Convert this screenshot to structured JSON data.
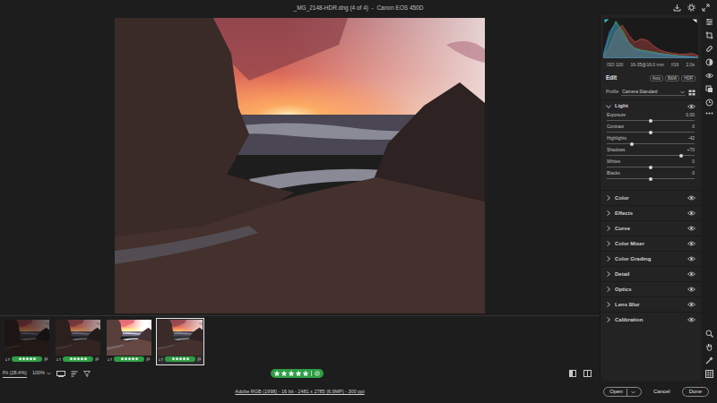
{
  "window": {
    "title": "_MG_2148-HDR.dng (4 of 4)  -  Canon EOS 450D"
  },
  "histogram": {
    "series": [
      {
        "color": "#e05050",
        "values": [
          4,
          28,
          66,
          82,
          58,
          40,
          48,
          44,
          30,
          20,
          15,
          12,
          10,
          10,
          12,
          6
        ]
      },
      {
        "color": "#40c060",
        "values": [
          6,
          55,
          92,
          70,
          40,
          25,
          20,
          18,
          15,
          12,
          10,
          8,
          6,
          5,
          4,
          2
        ]
      },
      {
        "color": "#4080e0",
        "values": [
          8,
          66,
          88,
          60,
          35,
          22,
          18,
          15,
          12,
          10,
          8,
          6,
          5,
          4,
          3,
          2
        ]
      }
    ]
  },
  "camera_info": [
    "ISO 100",
    "16-35@16.0 mm",
    "f/16",
    "2.0s"
  ],
  "edit": {
    "title": "Edit",
    "modes": [
      {
        "label": "Auto",
        "selected": false
      },
      {
        "label": "B&W",
        "selected": false
      },
      {
        "label": "HDR",
        "selected": false
      }
    ]
  },
  "profile": {
    "label": "Profile",
    "value": "Camera Standard"
  },
  "light": {
    "title": "Light",
    "expanded": true,
    "sliders": [
      {
        "name": "Exposure",
        "reading": "0.00",
        "level": 0.5
      },
      {
        "name": "Contrast",
        "reading": "0",
        "level": 0.5
      },
      {
        "name": "Highlights",
        "reading": "-42",
        "level": 0.29
      },
      {
        "name": "Shadows",
        "reading": "+70",
        "level": 0.85
      },
      {
        "name": "Whites",
        "reading": "0",
        "level": 0.5
      },
      {
        "name": "Blacks",
        "reading": "0",
        "level": 0.5
      }
    ]
  },
  "sections": [
    {
      "title": "Color",
      "expanded": false
    },
    {
      "title": "Effects",
      "expanded": false
    },
    {
      "title": "Curve",
      "expanded": false
    },
    {
      "title": "Color Mixer",
      "expanded": false
    },
    {
      "title": "Color Grading",
      "expanded": false
    },
    {
      "title": "Detail",
      "expanded": false
    },
    {
      "title": "Optics",
      "expanded": false
    },
    {
      "title": "Lens Blur",
      "expanded": false
    },
    {
      "title": "Calibration",
      "expanded": false
    }
  ],
  "filmstrip": [
    {
      "selected": false,
      "stars": 5
    },
    {
      "selected": false,
      "stars": 5
    },
    {
      "selected": false,
      "stars": 5
    },
    {
      "selected": true,
      "stars": 5
    }
  ],
  "zoom": {
    "options": [
      {
        "label": "Fit (28.4%)",
        "selected": true
      },
      {
        "label": "100%",
        "selected": false
      }
    ]
  },
  "rating": {
    "stars": 5
  },
  "footer": {
    "info": "Adobe RGB (1998) - 16 bit - 2481 x 2785 (6.9MP) - 300 ppi",
    "buttons": [
      "Open",
      "Cancel",
      "Done"
    ]
  }
}
